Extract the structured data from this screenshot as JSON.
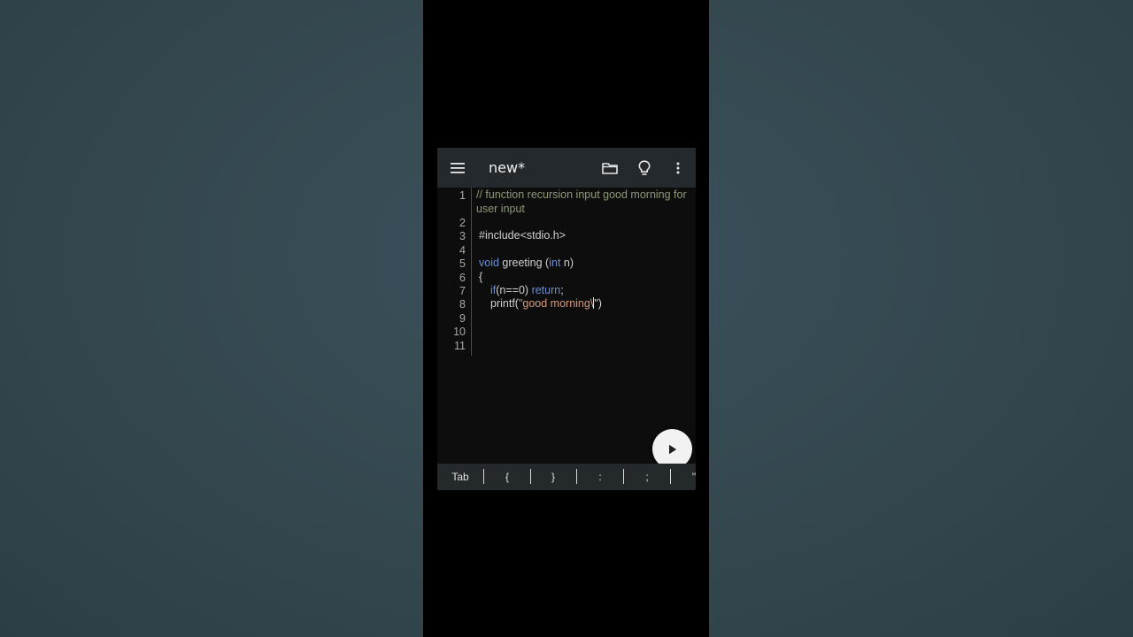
{
  "toolbar": {
    "title": "new*",
    "menu_icon": "hamburger-menu-icon",
    "folder_icon": "folder-icon",
    "hint_icon": "lightbulb-icon",
    "more_icon": "more-vertical-icon"
  },
  "editor": {
    "line_numbers": [
      "1",
      "2",
      "3",
      "4",
      "5",
      "6",
      "7",
      "8",
      "9",
      "10",
      "11"
    ],
    "comment": "// function recursion input good morning for user input",
    "include": "#include<stdio.h>",
    "func_kw": "void",
    "func_name": " greeting (",
    "param_kw": "int",
    "param_rest": " n)",
    "open_brace": "{",
    "if_kw": "if",
    "if_cond": "(n==0) ",
    "return_kw": "return",
    "semicolon": ";",
    "printf_call": "printf(",
    "string_lit": "\"good morning\\",
    "string_end": "\")"
  },
  "run_button": {
    "icon": "play-icon"
  },
  "shortcut_keys": [
    "Tab",
    "{",
    "}",
    ":",
    ";",
    "\""
  ],
  "colors": {
    "toolbar": "#23292d",
    "editor_bg": "#0d0d0d",
    "comment": "#8c9a77",
    "keyword": "#6d8fd0",
    "string": "#d59a7c"
  }
}
